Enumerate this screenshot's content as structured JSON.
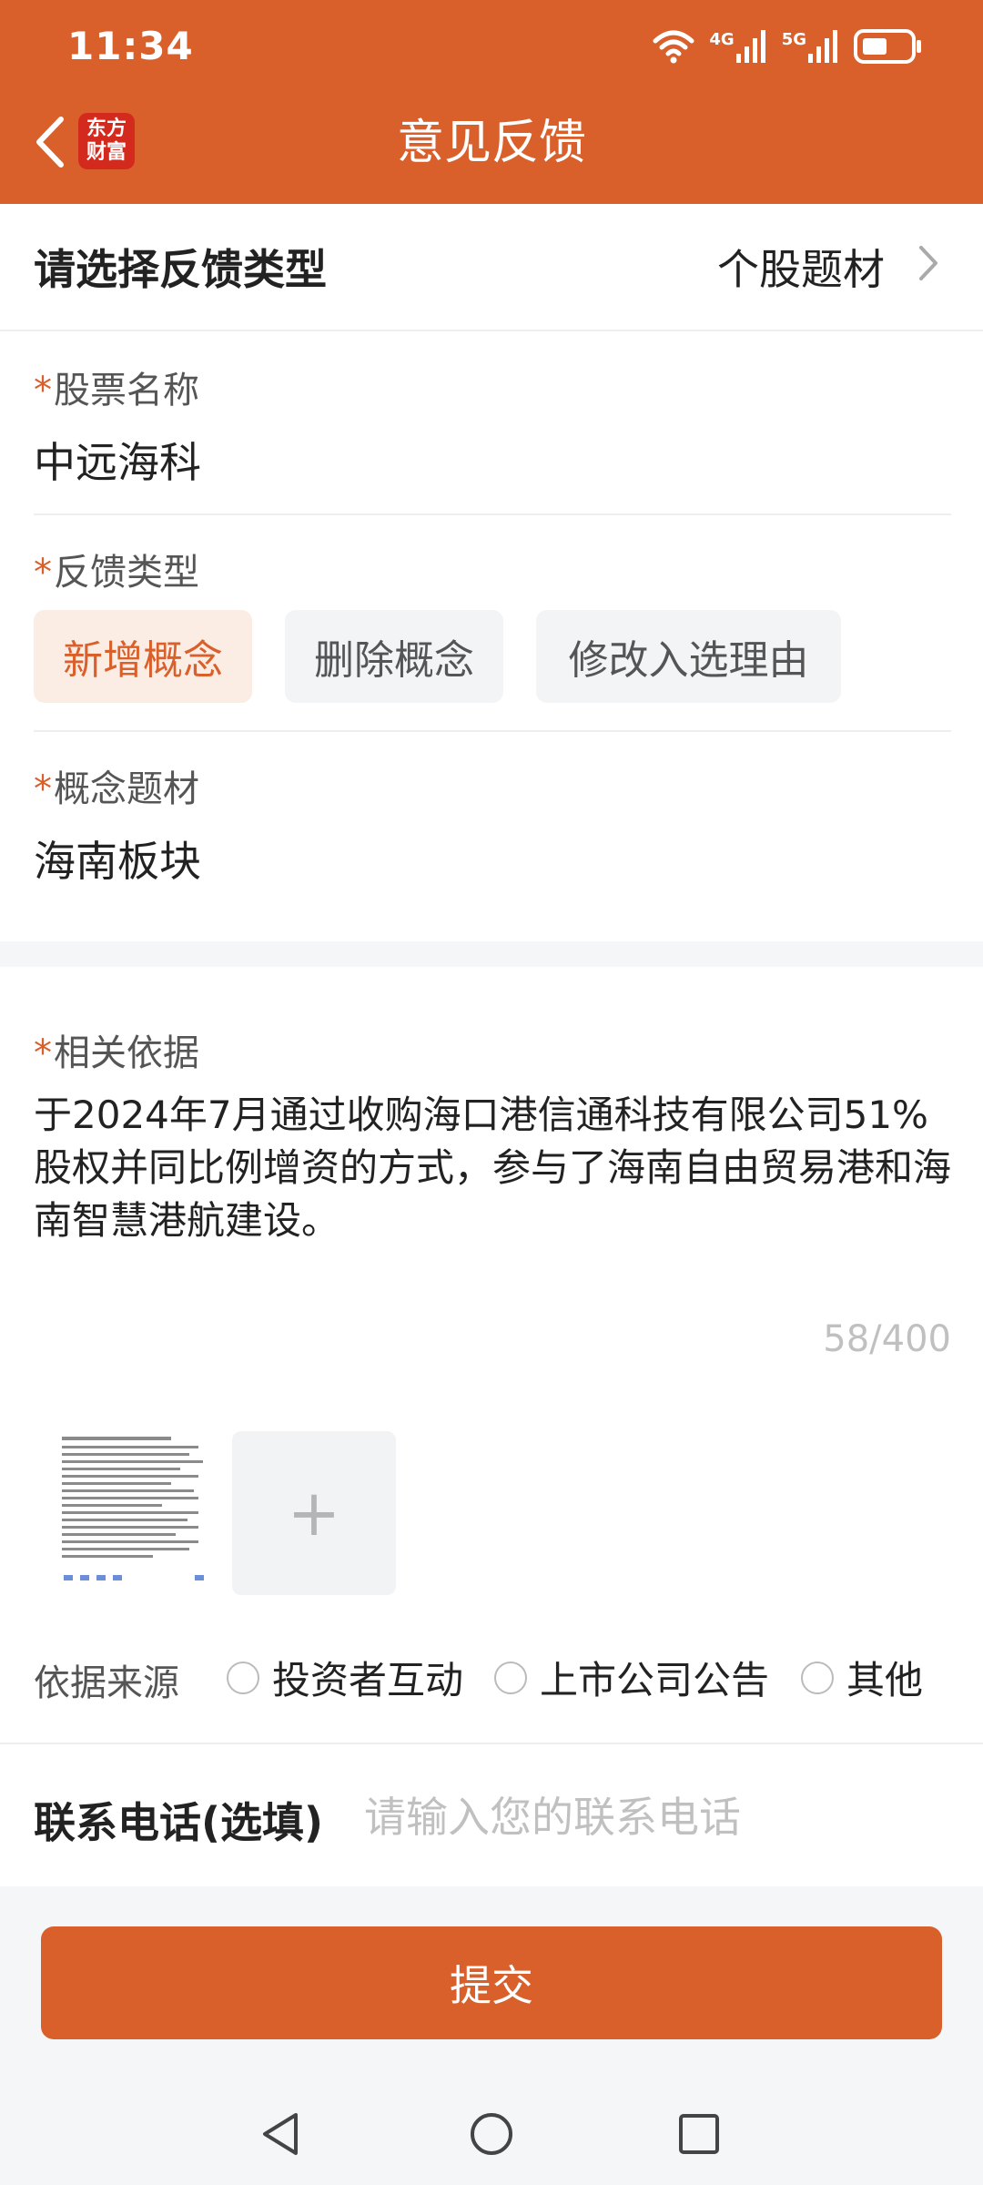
{
  "status_bar": {
    "time": "11:34",
    "net1": "4G",
    "net2": "5G"
  },
  "header": {
    "logo_line1": "东方",
    "logo_line2": "财富",
    "title": "意见反馈"
  },
  "feedback_category": {
    "label": "请选择反馈类型",
    "value": "个股题材"
  },
  "stock_name": {
    "required_mark": "*",
    "label": "股票名称",
    "value": "中远海科"
  },
  "feedback_type": {
    "required_mark": "*",
    "label": "反馈类型",
    "options": [
      "新增概念",
      "删除概念",
      "修改入选理由"
    ],
    "selected": "新增概念"
  },
  "concept": {
    "required_mark": "*",
    "label": "概念题材",
    "value": "海南板块"
  },
  "basis": {
    "required_mark": "*",
    "label": "相关依据",
    "text": "于2024年7月通过收购海口港信通科技有限公司51%股权并同比例增资的方式，参与了海南自由贸易港和海南智慧港航建设。",
    "counter": "58/400"
  },
  "upload": {
    "add_symbol": "+"
  },
  "source": {
    "label": "依据来源",
    "options": [
      "投资者互动",
      "上市公司公告",
      "其他"
    ]
  },
  "contact": {
    "label": "联系电话(选填)",
    "placeholder": "请输入您的联系电话",
    "value": ""
  },
  "submit_label": "提交",
  "colors": {
    "brand": "#D9602B",
    "logo_red": "#D42A1E",
    "chip_active_bg": "#FBEDE4",
    "chip_bg": "#F3F4F6"
  }
}
